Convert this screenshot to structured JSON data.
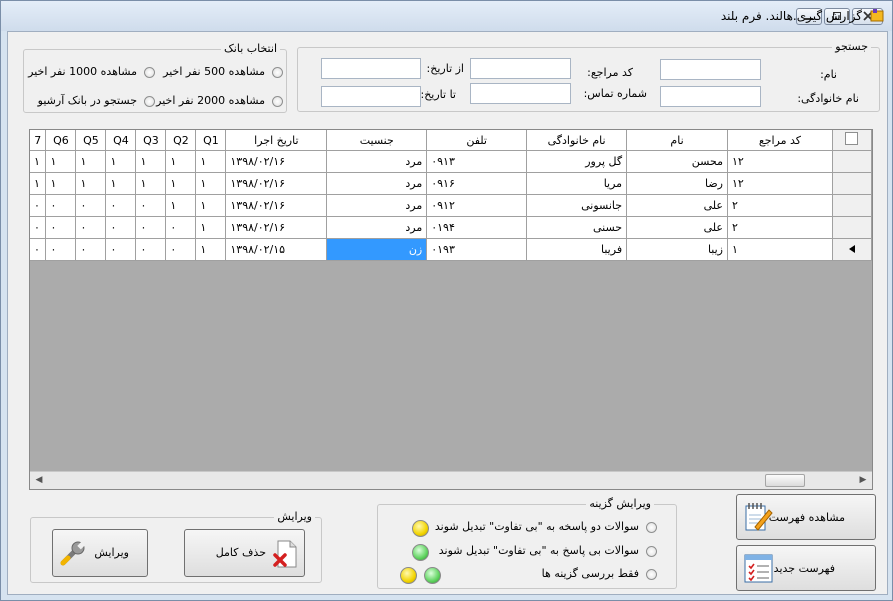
{
  "window": {
    "title": "گزارش گیری.هالند. فرم بلند"
  },
  "search": {
    "legend": "جستجو",
    "name_label": "نام:",
    "family_label": "نام خانوادگی:",
    "code_label": "کد مراجع:",
    "phone_label": "شماره تماس:",
    "from_date_label": "از تاریخ:",
    "to_date_label": "تا تاریخ:",
    "name_value": "",
    "family_value": "",
    "code_value": "",
    "phone_value": "",
    "from_date_value": "",
    "to_date_value": ""
  },
  "bank": {
    "legend": "انتخاب بانک",
    "opt_500": "مشاهده 500 نفر اخیر",
    "opt_1000": "مشاهده 1000 نفر اخیر",
    "opt_2000": "مشاهده 2000 نفر اخیر",
    "opt_archive": "جستجو در بانک آرشیو"
  },
  "grid": {
    "columns": {
      "code": "کد مراجع",
      "name": "نام",
      "family": "نام خانوادگی",
      "phone": "تلفن",
      "gender": "جنسیت",
      "date": "تاریخ اجرا",
      "q1": "Q1",
      "q2": "Q2",
      "q3": "Q3",
      "q4": "Q4",
      "q5": "Q5",
      "q6": "Q6",
      "q7": "7"
    },
    "rows": [
      {
        "code": "۱۲",
        "name": "محسن",
        "family": "گل پرور",
        "phone": "۰۹۱۳",
        "gender": "مرد",
        "date": "۱۳۹۸/۰۲/۱۶",
        "q1": "۱",
        "q2": "۱",
        "q3": "۱",
        "q4": "۱",
        "q5": "۱",
        "q6": "۱",
        "q7": "۱"
      },
      {
        "code": "۱۲",
        "name": "رضا",
        "family": "مریا",
        "phone": "۰۹۱۶",
        "gender": "مرد",
        "date": "۱۳۹۸/۰۲/۱۶",
        "q1": "۱",
        "q2": "۱",
        "q3": "۱",
        "q4": "۱",
        "q5": "۱",
        "q6": "۱",
        "q7": "۱"
      },
      {
        "code": "۲",
        "name": "علی",
        "family": "جانسونی",
        "phone": "۰۹۱۲",
        "gender": "مرد",
        "date": "۱۳۹۸/۰۲/۱۶",
        "q1": "۱",
        "q2": "۱",
        "q3": "۰",
        "q4": "۰",
        "q5": "۰",
        "q6": "۰",
        "q7": "۰"
      },
      {
        "code": "۲",
        "name": "علی",
        "family": "حسنی",
        "phone": "۰۱۹۴",
        "gender": "مرد",
        "date": "۱۳۹۸/۰۲/۱۶",
        "q1": "۱",
        "q2": "۰",
        "q3": "۰",
        "q4": "۰",
        "q5": "۰",
        "q6": "۰",
        "q7": "۰"
      },
      {
        "code": "۱",
        "name": "زیبا",
        "family": "فریبا",
        "phone": "۰۱۹۳",
        "gender": "زن",
        "date": "۱۳۹۸/۰۲/۱۵",
        "q1": "۱",
        "q2": "۰",
        "q3": "۰",
        "q4": "۰",
        "q5": "۰",
        "q6": "۰",
        "q7": "۰"
      }
    ]
  },
  "edit_group": {
    "legend": "ویرایش",
    "edit_button": "ویرایش",
    "delete_button": "حذف کامل"
  },
  "option_group": {
    "legend": "ویرایش گزینه",
    "opt_two_answer": "سوالات دو پاسخه به \"بی تفاوت\" تبدیل شوند",
    "opt_no_answer": "سوالات بی پاسخ به \"بی تفاوت\" تبدیل شوند",
    "opt_review": "فقط بررسی گزینه ها"
  },
  "list_buttons": {
    "view_list": "مشاهده فهرست",
    "new_list": "فهرست جدید"
  },
  "colors": {
    "selection": "#3399ff",
    "led_yellow": "#f2d400",
    "led_green": "#5fd35f"
  }
}
